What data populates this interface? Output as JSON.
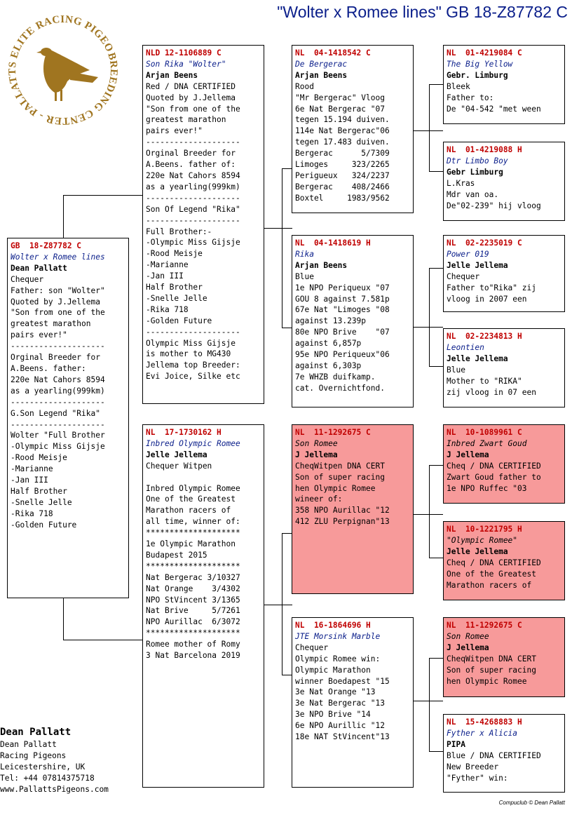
{
  "header": {
    "title": "\"Wolter x Romee lines\"  GB  18-Z87782 C"
  },
  "logo": {
    "circle_text": "BREEDING CENTER - PALLATTS ELITE RACING PIGEONS",
    "icon": "pigeon-icon",
    "color": "#a07520"
  },
  "pigeons": {
    "subject": {
      "ring": "GB  18-Z87782 C",
      "name": "Wolter x Romee lines",
      "owner": "Dean Pallatt",
      "lines": [
        "Chequer",
        "Father: son \"Wolter\"",
        "Quoted by J.Jellema",
        "\"Son from one of the",
        "greatest marathon",
        "pairs ever!\"",
        "--------------------",
        "Orginal Breeder for",
        "A.Beens. father:",
        "220e Nat Cahors 8594",
        "as a yearling(999km)",
        "--------------------",
        "G.Son Legend \"Rika\"",
        "--------------------",
        "Wolter \"Full Brother",
        "-Olympic Miss Gijsje",
        "-Rood Meisje",
        "-Marianne",
        "-Jan III",
        "Half Brother",
        "-Snelle Jelle",
        "-Rika 718",
        "-Golden Future"
      ]
    },
    "sire": {
      "ring": "NLD 12-1106889 C",
      "name": "Son Rika \"Wolter\"",
      "owner": "Arjan Beens",
      "lines": [
        "Red / DNA CERTIFIED",
        "Quoted by J.Jellema",
        "\"Son from one of the",
        "greatest marathon",
        "pairs ever!\"",
        "--------------------",
        "Orginal Breeder for",
        "A.Beens. father of:",
        "220e Nat Cahors 8594",
        "as a yearling(999km)",
        "--------------------",
        "Son Of Legend \"Rika\"",
        "--------------------",
        "Full Brother:-",
        "-Olympic Miss Gijsje",
        "-Rood Meisje",
        "-Marianne",
        "-Jan III",
        "Half Brother",
        "-Snelle Jelle",
        "-Rika 718",
        "-Golden Future",
        "--------------------",
        "Olympic Miss Gijsje",
        "is mother to MG430",
        "Jellema top Breeder:",
        "Evi Joice, Silke etc"
      ]
    },
    "dam": {
      "ring": "NL  17-1730162 H",
      "name": "Inbred Olympic Romee",
      "owner": "Jelle Jellema",
      "lines": [
        "Chequer Witpen",
        "",
        "Inbred Olympic Romee",
        "One of the Greatest",
        "Marathon racers of",
        "all time, winner of:",
        "********************",
        "1e Olympic Marathon",
        "Budapest 2015",
        "********************",
        "Nat Bergerac 3/10327",
        "Nat Orange    3/4302",
        "NPO StVincent 3/1365",
        "Nat Brive     5/7261",
        "NPO Aurillac  6/3072",
        "********************",
        "Romee mother of Romy",
        "3 Nat Barcelona 2019"
      ]
    },
    "ss": {
      "ring": "NL  04-1418542 C",
      "name": "De Bergerac",
      "owner": "Arjan Beens",
      "lines": [
        "Rood",
        "\"Mr Bergerac\" Vloog",
        "6e Nat Bergerac \"07",
        "tegen 15.194 duiven.",
        "114e Nat Bergerac\"06",
        "tegen 17.483 duiven.",
        "Bergerac      5/7309",
        "Limoges     323/2265",
        "Perigueux   324/2237",
        "Bergerac    408/2466",
        "Boxtel     1983/9562"
      ]
    },
    "sd": {
      "ring": "NL  04-1418619 H",
      "name": "Rika",
      "owner": "Arjan Beens",
      "lines": [
        "Blue",
        "1e NPO Periqueux \"07",
        "GOU 8 against 7.581p",
        "67e Nat \"Limoges \"08",
        "against 13.239p",
        "80e NPO Brive    \"07",
        "against 6,857p",
        "95e NPO Periqueux\"06",
        "against 6,303p",
        "7e WHZB duifkamp.",
        "cat. Overnichtfond."
      ]
    },
    "ds": {
      "ring": "NL  11-1292675 C",
      "name": "Son Romee",
      "owner": "J Jellema",
      "lines": [
        "CheqWitpen DNA CERT",
        "Son of super racing",
        "hen Olympic Romee",
        "wineer of:",
        "358 NPO Aurillac \"12",
        "412 ZLU Perpignan\"13"
      ]
    },
    "dd": {
      "ring": "NL  16-1864696 H",
      "name": "JTE Morsink Marble",
      "owner": "",
      "lines": [
        "Chequer",
        "Olympic Romee win:",
        "Olympic Marathon",
        "winner Boedapest \"15",
        "3e Nat Orange \"13",
        "3e Nat Bergerac \"13",
        "3e NPO Brive \"14",
        "6e NPO Aurillic \"12",
        "18e NAT StVincent\"13"
      ]
    },
    "sss": {
      "ring": "NL  01-4219084 C",
      "name": "The Big Yellow",
      "owner": "Gebr. Limburg",
      "lines": [
        "Bleek",
        "Father to:",
        "De \"04-542 \"met ween"
      ]
    },
    "ssd": {
      "ring": "NL  01-4219088 H",
      "name": "Dtr Limbo Boy",
      "owner": "Gebr Limburg",
      "lines": [
        "L.Kras",
        "Mdr van oa.",
        "De\"02-239\" hij vloog"
      ]
    },
    "sds": {
      "ring": "NL  02-2235019 C",
      "name": "Power 019",
      "owner": "Jelle Jellema",
      "lines": [
        "Chequer",
        "Father to\"Rika\" zij",
        "vloog in 2007 een"
      ]
    },
    "sdd": {
      "ring": "NL  02-2234813 H",
      "name": "Leontien",
      "owner": "Jelle Jellema",
      "lines": [
        "Blue",
        "Mother to \"RIKA\"",
        "zij vloog in 07 een"
      ]
    },
    "dss": {
      "ring": "NL  10-1089961 C",
      "name": "Inbred Zwart Goud",
      "owner": "J Jellema",
      "lines": [
        "Cheq / DNA CERTIFIED",
        "Zwart Goud father to",
        "1e NPO Ruffec \"03"
      ]
    },
    "dsd": {
      "ring": "NL  10-1221795 H",
      "name": "\"Olympic Romee\"",
      "owner": "Jelle Jellema",
      "lines": [
        "Cheq / DNA CERTIFIED",
        "One of the Greatest",
        "Marathon racers of"
      ]
    },
    "dds": {
      "ring": "NL  11-1292675 C",
      "name": "Son Romee",
      "owner": "J Jellema",
      "lines": [
        "CheqWitpen DNA CERT",
        "Son of super racing",
        "hen Olympic Romee"
      ]
    },
    "ddd": {
      "ring": "NL  15-4268883 H",
      "name": "Fyther x Alicia",
      "owner": "PIPA",
      "lines": [
        "Blue / DNA CERTIFIED",
        "New Breeder",
        "\"Fyther\" win:"
      ]
    }
  },
  "footer": {
    "name": "Dean Pallatt",
    "lines": [
      "Dean Pallatt",
      "Racing Pigeons",
      "Leicestershire, UK",
      "Tel: +44 07814375718",
      "www.PallattsPigeons.com"
    ],
    "credit": "Compuclub © Dean Pallatt"
  },
  "colors": {
    "ring": "#c00000",
    "name": "#0a1e8a",
    "highlight": "#f79a9a",
    "title": "#0a1e8a"
  }
}
